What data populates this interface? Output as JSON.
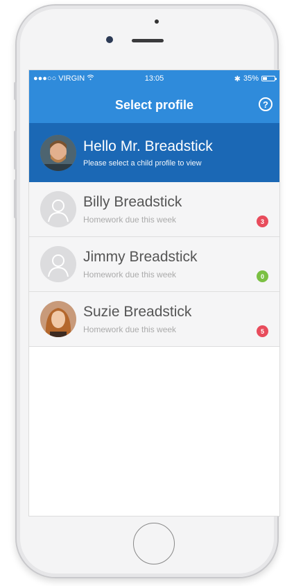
{
  "statusbar": {
    "carrier": "●●●○○ VIRGIN",
    "wifi_icon": "wifi-icon",
    "time": "13:05",
    "bluetooth": "✱",
    "battery": "35%"
  },
  "navbar": {
    "title": "Select profile",
    "help": "?"
  },
  "greeting": {
    "title": "Hello Mr. Breadstick",
    "subtitle": "Please select a child profile to view"
  },
  "children": [
    {
      "name": "Billy Breadstick",
      "subtitle": "Homework due this week",
      "count": "3",
      "badge_color": "#e84c5c",
      "avatar": "placeholder"
    },
    {
      "name": "Jimmy Breadstick",
      "subtitle": "Homework due this week",
      "count": "0",
      "badge_color": "#7bc043",
      "avatar": "placeholder"
    },
    {
      "name": "Suzie Breadstick",
      "subtitle": "Homework due this week",
      "count": "5",
      "badge_color": "#e84c5c",
      "avatar": "photo"
    }
  ],
  "colors": {
    "navbar": "#2f8bdb",
    "highlight": "#1b68b5"
  }
}
